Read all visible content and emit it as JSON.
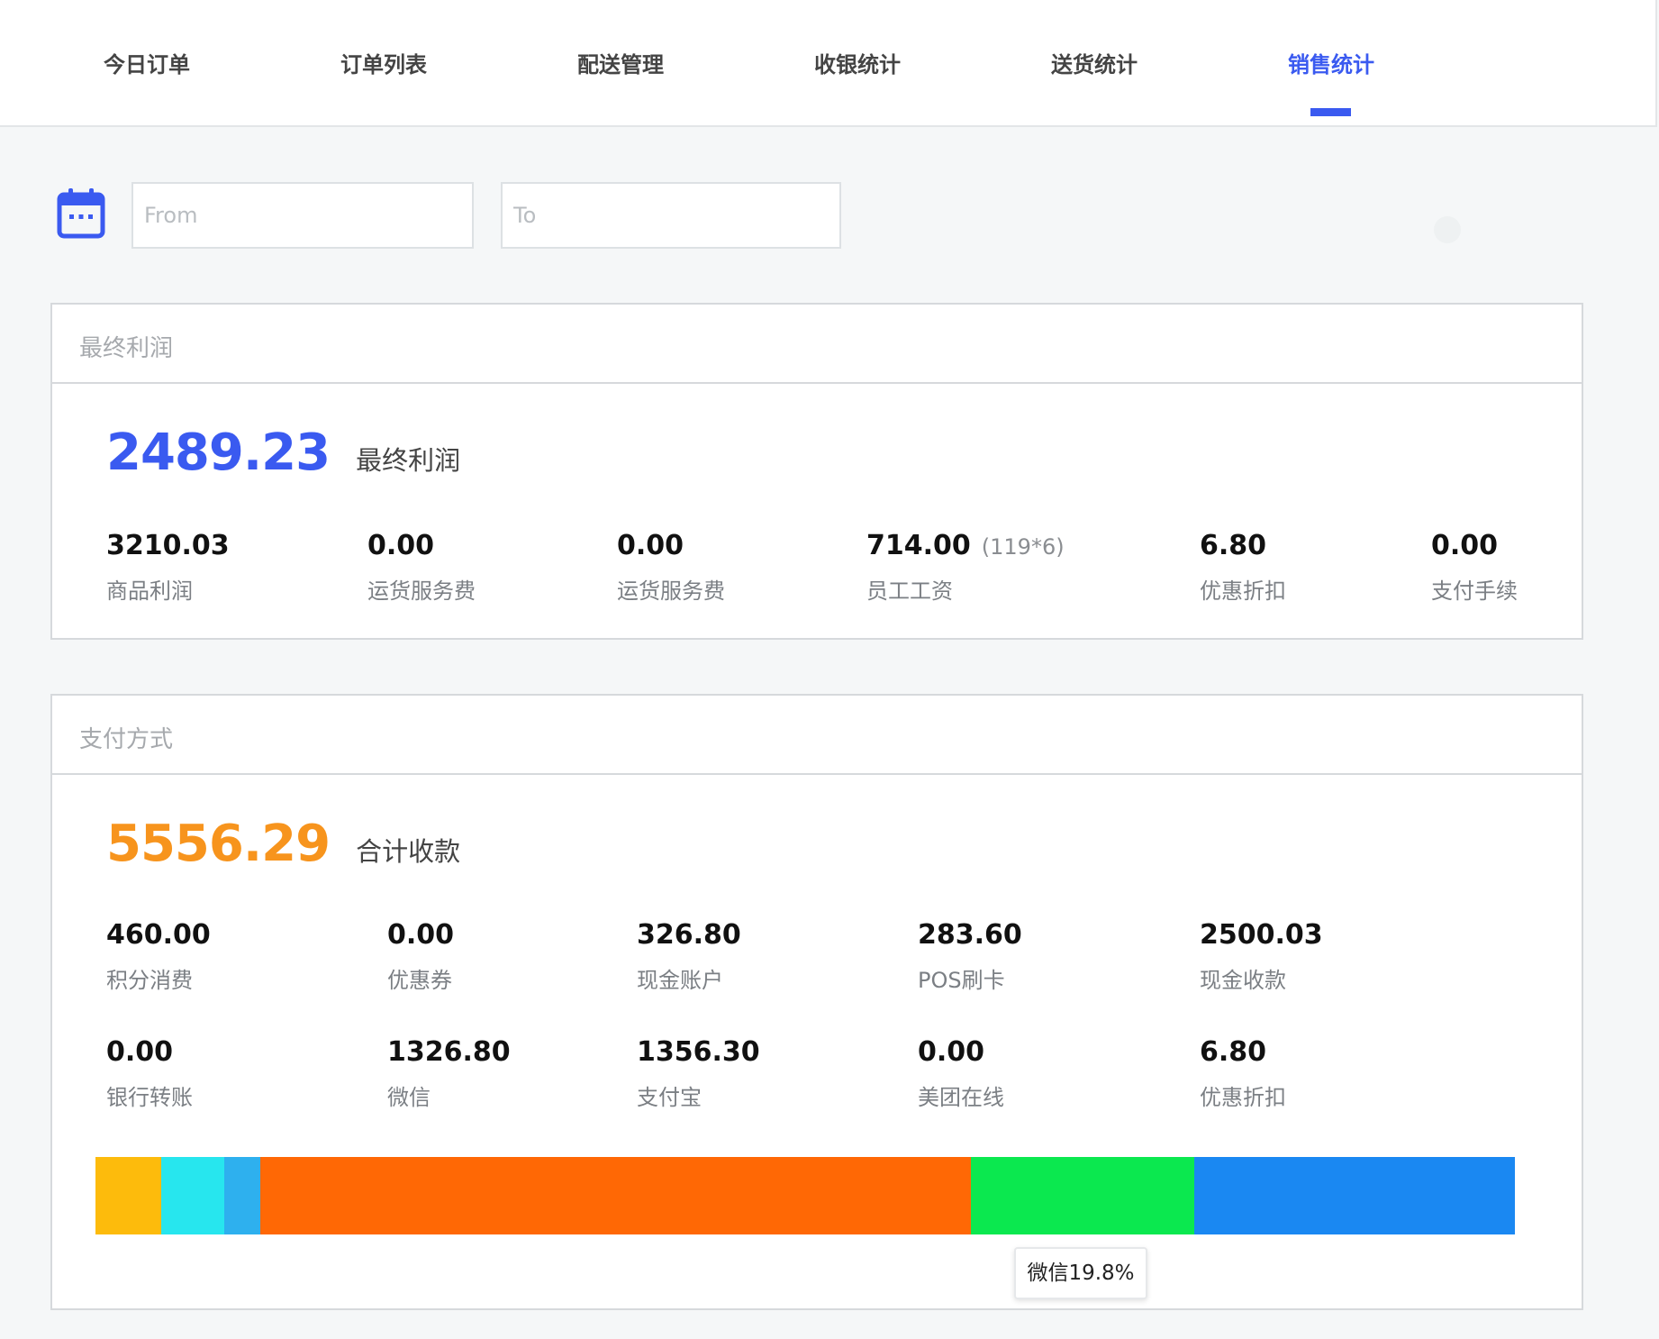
{
  "tabs": [
    {
      "label": "今日订单"
    },
    {
      "label": "订单列表"
    },
    {
      "label": "配送管理"
    },
    {
      "label": "收银统计"
    },
    {
      "label": "送货统计"
    },
    {
      "label": "销售统计",
      "active": true
    }
  ],
  "filter": {
    "icon": "calendar-icon",
    "from_placeholder": "From",
    "to_placeholder": "To"
  },
  "profit": {
    "header": "最终利润",
    "total_value": "2489.23",
    "total_label": "最终利润",
    "total_color": "#3a5af0",
    "items": [
      {
        "value": "3210.03",
        "label": "商品利润"
      },
      {
        "value": "0.00",
        "label": "运货服务费"
      },
      {
        "value": "0.00",
        "label": "运货服务费"
      },
      {
        "value": "714.00",
        "note": "(119*6)",
        "label": "员工工资"
      },
      {
        "value": "6.80",
        "label": "优惠折扣"
      },
      {
        "value": "0.00",
        "label": "支付手续"
      }
    ]
  },
  "payment": {
    "header": "支付方式",
    "total_value": "5556.29",
    "total_label": "合计收款",
    "total_color": "#f7941d",
    "items": [
      {
        "value": "460.00",
        "label": "积分消费"
      },
      {
        "value": "0.00",
        "label": "优惠券"
      },
      {
        "value": "326.80",
        "label": "现金账户"
      },
      {
        "value": "283.60",
        "label": "POS刷卡"
      },
      {
        "value": "2500.03",
        "label": "现金收款"
      },
      {
        "value": "0.00",
        "label": "银行转账"
      },
      {
        "value": "1326.80",
        "label": "微信"
      },
      {
        "value": "1356.30",
        "label": "支付宝"
      },
      {
        "value": "0.00",
        "label": "美团在线"
      },
      {
        "value": "6.80",
        "label": "优惠折扣"
      }
    ],
    "bar_segments": [
      {
        "share": 0.0466,
        "color": "#fdbb0c"
      },
      {
        "share": 0.0445,
        "color": "#27e6ee"
      },
      {
        "share": 0.0251,
        "color": "#2eb0ee"
      },
      {
        "share": 0.5006,
        "color": "#ff6805"
      },
      {
        "share": 0.1572,
        "color": "#0be84f"
      },
      {
        "share": 0.226,
        "color": "#1a88f2"
      }
    ],
    "tooltip": "微信19.8%"
  }
}
